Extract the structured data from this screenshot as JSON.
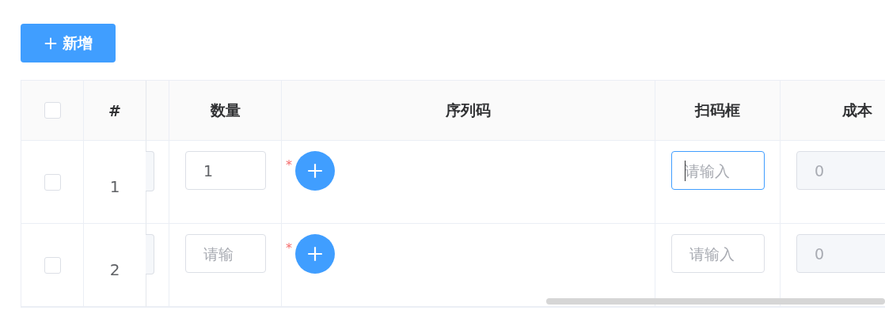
{
  "add_button": {
    "label": "新增"
  },
  "table": {
    "header": {
      "checked": false,
      "columns": [
        "#",
        "数量",
        "序列码",
        "扫码框",
        "成本"
      ]
    },
    "rows": [
      {
        "checked": false,
        "index": "1",
        "quantity": {
          "value": "1"
        },
        "required_mark": "*",
        "scan": {
          "placeholder": "请输入",
          "focused": true
        },
        "cost": {
          "value": "0",
          "disabled": true
        }
      },
      {
        "checked": false,
        "index": "2",
        "quantity": {
          "placeholder": "请输"
        },
        "required_mark": "*",
        "scan": {
          "placeholder": "请输入",
          "focused": false
        },
        "cost": {
          "value": "0",
          "disabled": true
        }
      }
    ]
  }
}
